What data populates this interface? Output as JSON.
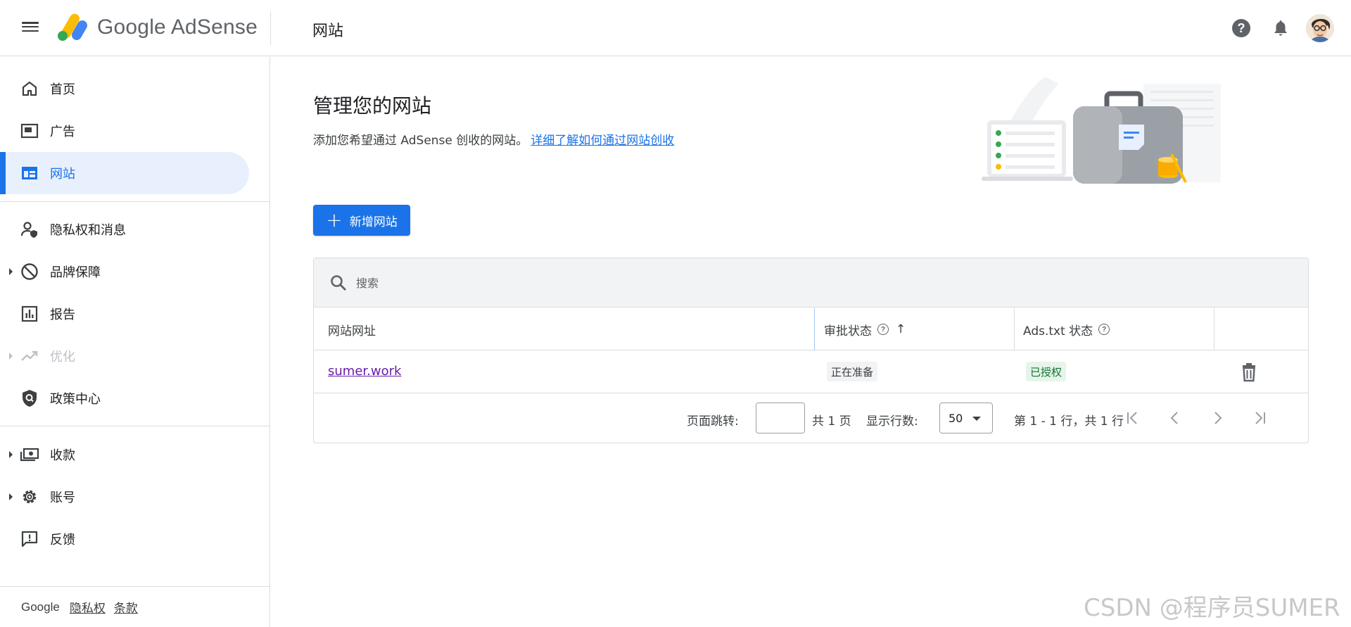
{
  "app": {
    "brand": "Google AdSense",
    "page_title": "网站"
  },
  "sidebar": {
    "items": [
      {
        "label": "首页",
        "icon": "home-icon",
        "active": false
      },
      {
        "label": "广告",
        "icon": "ads-icon",
        "active": false
      },
      {
        "label": "网站",
        "icon": "sites-icon",
        "active": true
      },
      {
        "label": "隐私权和消息",
        "icon": "privacy-icon",
        "active": false
      },
      {
        "label": "品牌保障",
        "icon": "block-icon",
        "active": false,
        "expandable": true
      },
      {
        "label": "报告",
        "icon": "reports-icon",
        "active": false
      },
      {
        "label": "优化",
        "icon": "trending-icon",
        "active": false,
        "expandable": true,
        "disabled": true
      },
      {
        "label": "政策中心",
        "icon": "policy-icon",
        "active": false
      },
      {
        "label": "收款",
        "icon": "payments-icon",
        "active": false,
        "expandable": true
      },
      {
        "label": "账号",
        "icon": "gear-icon",
        "active": false,
        "expandable": true
      },
      {
        "label": "反馈",
        "icon": "feedback-icon",
        "active": false
      }
    ],
    "footer": {
      "google": "Google",
      "privacy": "隐私权",
      "terms": "条款"
    }
  },
  "main": {
    "heading": "管理您的网站",
    "description": "添加您希望通过 AdSense 创收的网站。",
    "learn_more": "详细了解如何通过网站创收",
    "add_button": "新增网站",
    "search_placeholder": "搜索",
    "table": {
      "columns": [
        "网站网址",
        "审批状态",
        "Ads.txt 状态"
      ],
      "rows": [
        {
          "site": "sumer.work",
          "approval": "正在准备",
          "ads_txt": "已授权"
        }
      ]
    },
    "pager": {
      "jump_label": "页面跳转:",
      "total_pages": "共 1 页",
      "rows_label": "显示行数:",
      "rows_value": "50",
      "range": "第 1 - 1 行，共 1 行"
    }
  },
  "watermark": "CSDN @程序员SUMER",
  "colors": {
    "accent": "#1a73e8",
    "active_bg": "#e8f0fe",
    "visited_link": "#681da8",
    "chip_green_bg": "#e6f4ea",
    "chip_green_text": "#137333"
  }
}
